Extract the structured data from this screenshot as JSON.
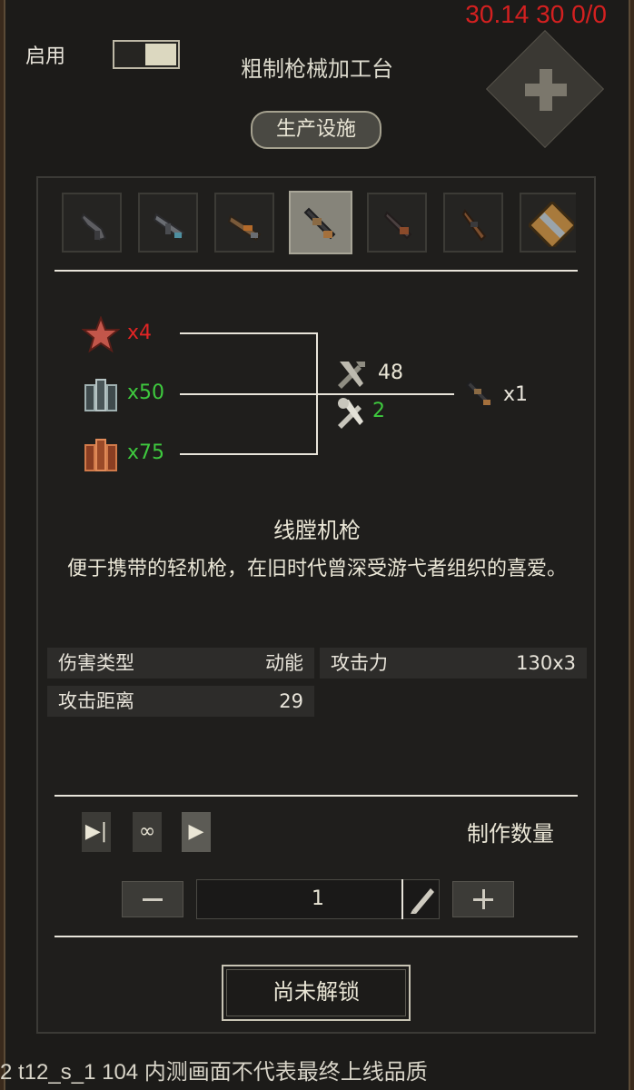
{
  "debug_text": "30.14 30 0/0",
  "enable_label": "启用",
  "station_title": "粗制枪械加工台",
  "facility_badge": "生产设施",
  "tabs": [
    {
      "icon": "pistol-icon"
    },
    {
      "icon": "smg-icon"
    },
    {
      "icon": "shotgun-icon"
    },
    {
      "icon": "machine-gun-icon",
      "active": true
    },
    {
      "icon": "rifle-icon"
    },
    {
      "icon": "carbine-icon"
    },
    {
      "icon": "crate-icon"
    }
  ],
  "recipe": {
    "ingredients": [
      {
        "icon": "red-star-icon",
        "count": "x4",
        "color": "#e02424"
      },
      {
        "icon": "steel-plates-icon",
        "count": "x50",
        "color": "#3ec93e"
      },
      {
        "icon": "copper-plates-icon",
        "count": "x75",
        "color": "#3ec93e"
      }
    ],
    "work_value": "48",
    "tool_value": "2",
    "output_count": "x1"
  },
  "item": {
    "name": "线膛机枪",
    "description": "便于携带的轻机枪，在旧时代曾深受游弋者组织的喜爱。"
  },
  "stats": [
    {
      "key": "伤害类型",
      "value": "动能"
    },
    {
      "key": "攻击力",
      "value": "130x3"
    },
    {
      "key": "攻击距离",
      "value": "29"
    }
  ],
  "craft": {
    "mode_buttons": [
      "▶|",
      "∞",
      "▶"
    ],
    "quantity_label": "制作数量",
    "quantity": "1",
    "minus_icon": "minus-icon",
    "plus_icon": "plus-icon",
    "edit_icon": "pencil-icon"
  },
  "unlock_button": "尚未解锁",
  "watermark": "2 t12_s_1 104  内测画面不代表最终上线品质"
}
